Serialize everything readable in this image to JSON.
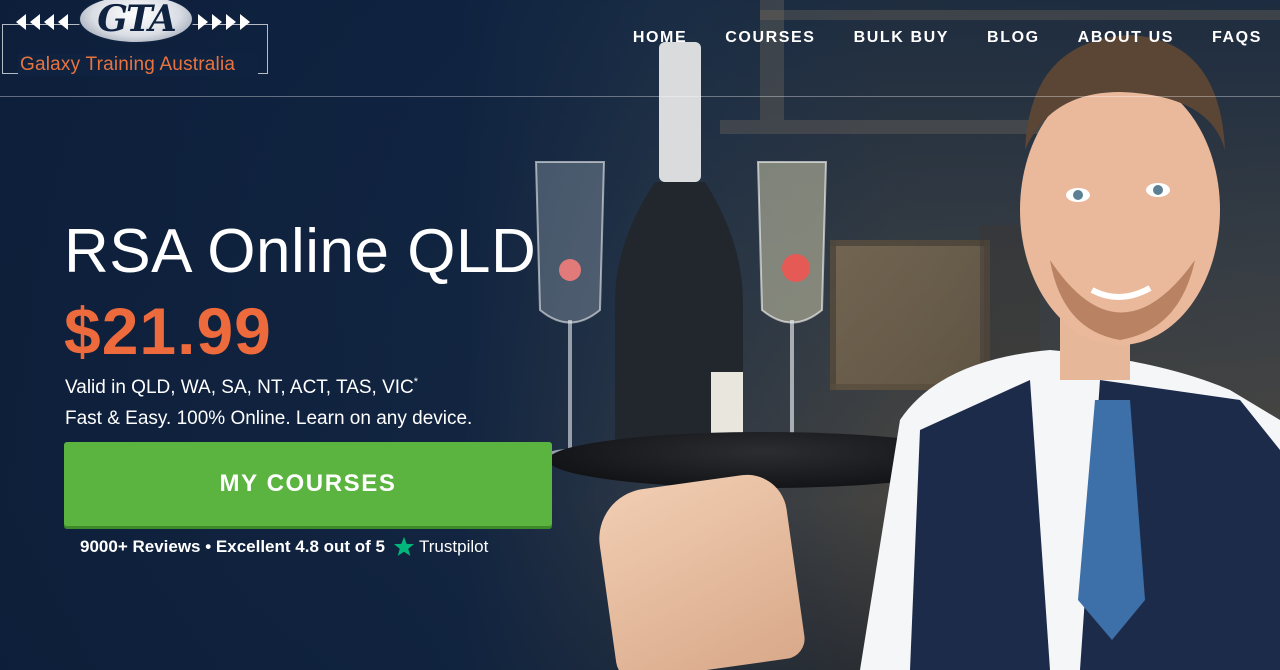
{
  "logo": {
    "letters": "GTA",
    "name": "Galaxy Training Australia"
  },
  "nav": {
    "items": [
      "HOME",
      "COURSES",
      "BULK BUY",
      "BLOG",
      "ABOUT US",
      "FAQS"
    ]
  },
  "hero": {
    "title": "RSA Online QLD",
    "price": "$21.99",
    "valid_text": "Valid in QLD, WA, SA, NT, ACT, TAS, VIC",
    "valid_footnote": "*",
    "tagline": "Fast & Easy. 100% Online. Learn on any device.",
    "cta_label": "MY COURSES",
    "reviews_text": "9000+ Reviews • Excellent 4.8 out of 5",
    "trustpilot_label": "Trustpilot"
  },
  "colors": {
    "background": "#0f2340",
    "price": "#ec6a3c",
    "cta": "#5bb440",
    "logo_text": "#e9733f",
    "trustpilot_star": "#00b67a"
  },
  "icons": [
    "logo-emblem",
    "trustpilot-star-icon"
  ]
}
